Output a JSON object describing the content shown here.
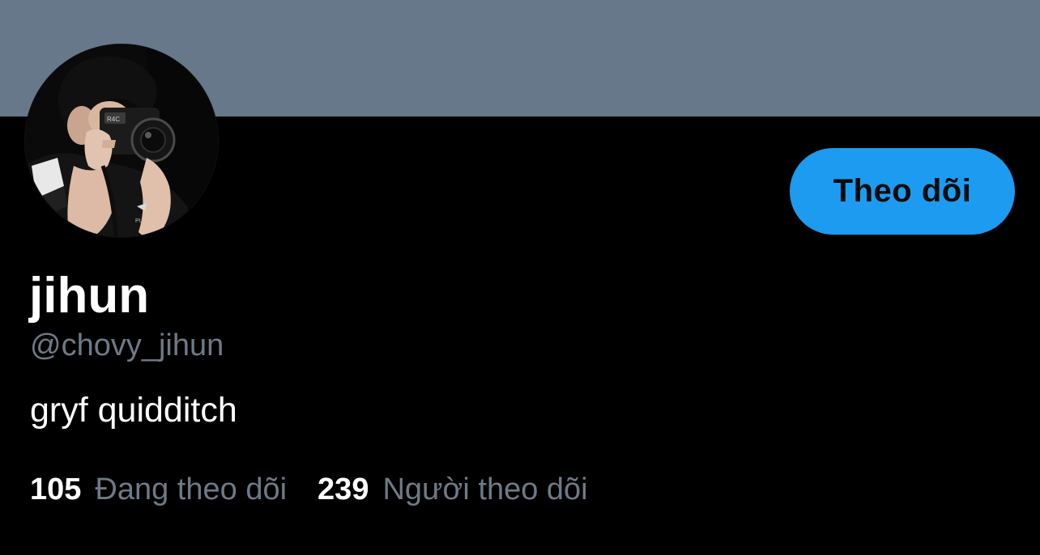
{
  "profile": {
    "banner_color": "#66788a",
    "avatar_icon": "profile-photo-person-with-camera",
    "display_name": "jihun",
    "handle": "@chovy_jihun",
    "bio": "gryf quidditch"
  },
  "actions": {
    "follow_label": "Theo dõi",
    "follow_color": "#1d9bf0"
  },
  "stats": {
    "following_count": "105",
    "following_label": "Đang theo dõi",
    "followers_count": "239",
    "followers_label": "Người theo dõi"
  }
}
